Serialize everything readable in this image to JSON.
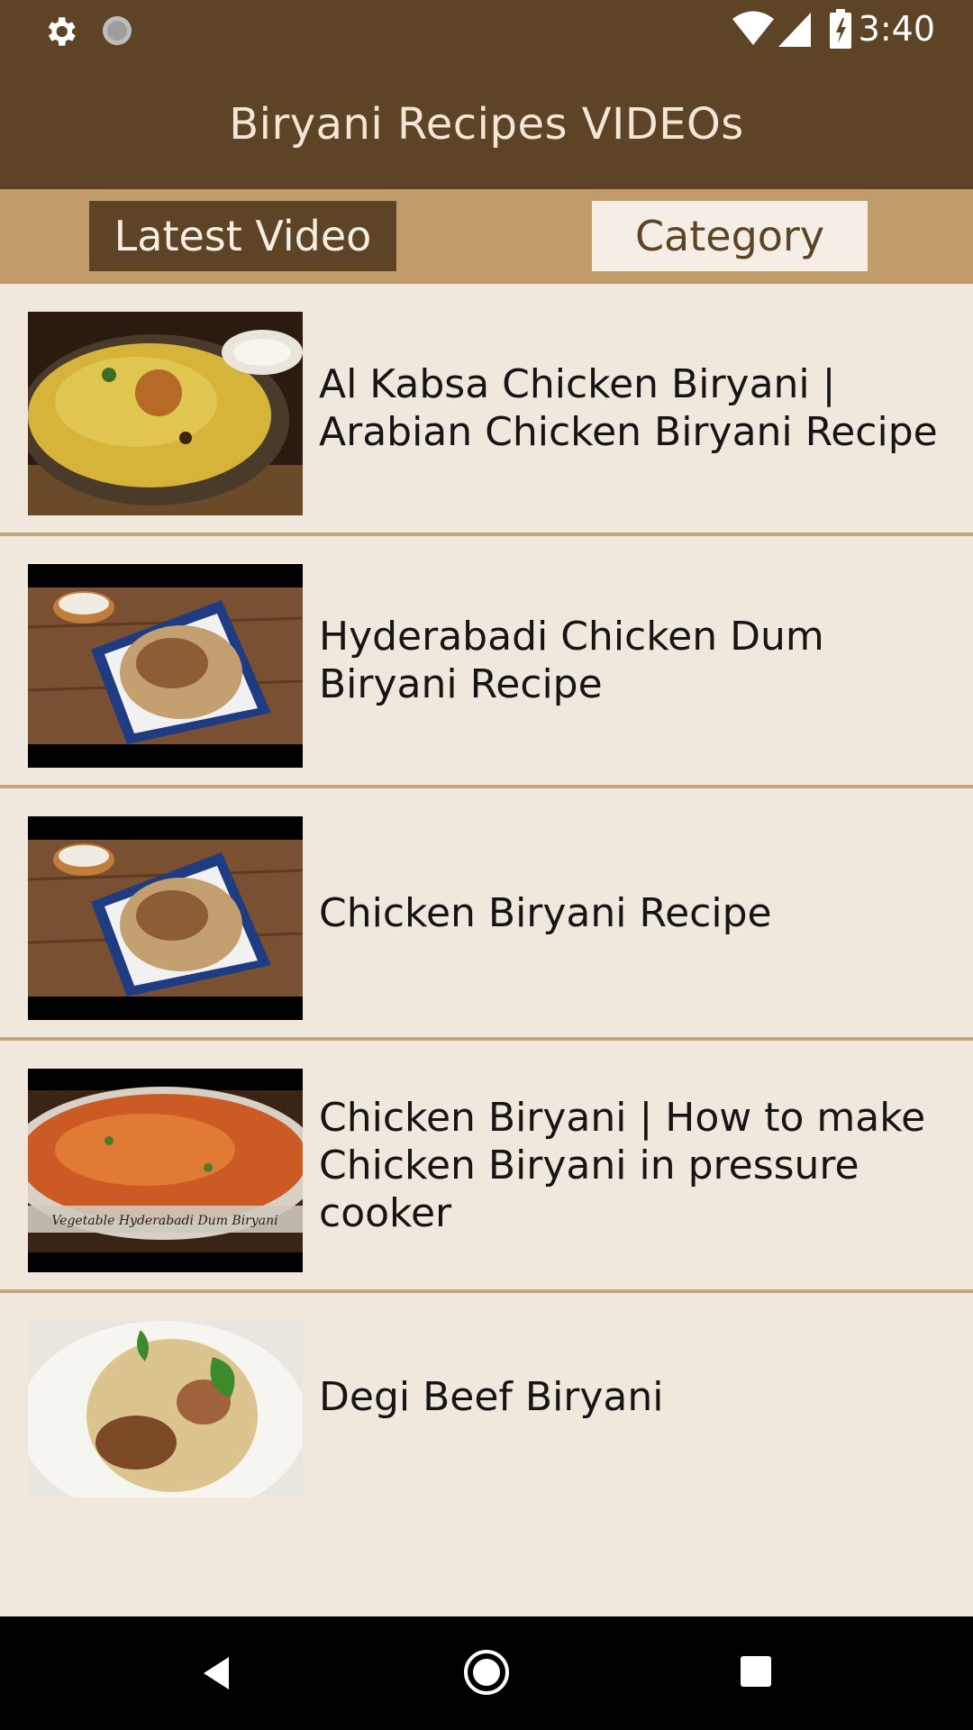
{
  "status_bar": {
    "time": "3:40",
    "icons": [
      "settings-icon",
      "loading-icon",
      "wifi-icon",
      "signal-icon",
      "battery-icon"
    ]
  },
  "app_bar": {
    "title": "Biryani Recipes VIDEOs"
  },
  "tabs": [
    {
      "label": "Latest Video",
      "selected": true
    },
    {
      "label": "Category",
      "selected": false
    }
  ],
  "videos": [
    {
      "title": "Al Kabsa Chicken Biryani | Arabian Chicken Biryani Recipe"
    },
    {
      "title": "Hyderabadi Chicken Dum Biryani Recipe"
    },
    {
      "title": "Chicken Biryani Recipe"
    },
    {
      "title": "Chicken Biryani | How to make Chicken Biryani in pressure cooker"
    },
    {
      "title": "Degi Beef Biryani"
    }
  ],
  "thumbnail_captions": {
    "vegetable_biryani": "Vegetable Hyderabadi Dum Biryani"
  },
  "nav_bar": {
    "icons": [
      "back-icon",
      "home-icon",
      "recents-icon"
    ]
  },
  "colors": {
    "primary": "#5E4426",
    "tab_strip": "#C19C6A",
    "list_bg": "#F0E7DD",
    "divider": "#C4A77F"
  }
}
